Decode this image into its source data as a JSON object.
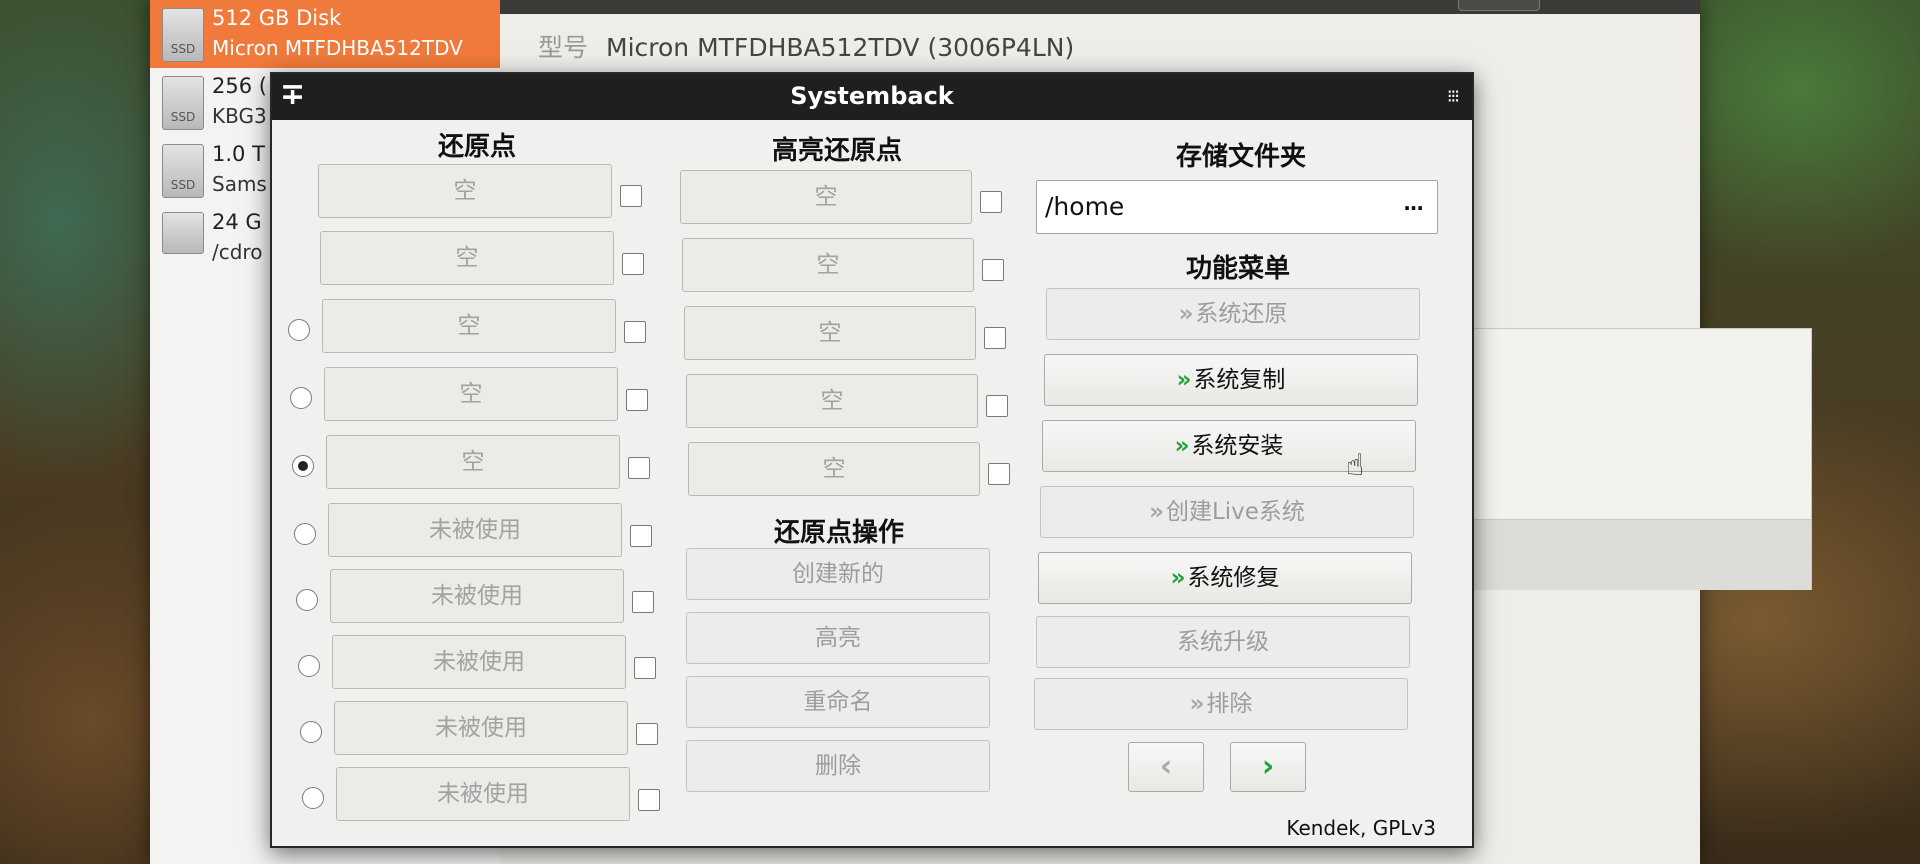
{
  "disks_app": {
    "list": [
      {
        "name": "512 GB Disk",
        "sub": "Micron MTFDHBA512TDV",
        "badge": "SSD",
        "selected": true
      },
      {
        "name": "256 (",
        "sub": "KBG3",
        "badge": "SSD",
        "selected": false
      },
      {
        "name": "1.0 T",
        "sub": "Sams",
        "badge": "SSD",
        "selected": false
      },
      {
        "name": "24 G",
        "sub": "/cdro",
        "badge": "",
        "selected": false
      }
    ],
    "model_label": "型号",
    "model_value": "Micron MTFDHBA512TDV (3006P4LN)"
  },
  "systemback": {
    "title": "Systemback",
    "restore_points": {
      "heading": "还原点",
      "slots": [
        "空",
        "空",
        "空",
        "空",
        "空",
        "未被使用",
        "未被使用",
        "未被使用",
        "未被使用",
        "未被使用"
      ],
      "selected_index": 4
    },
    "highlighted_points": {
      "heading": "高亮还原点",
      "slots": [
        "空",
        "空",
        "空",
        "空",
        "空"
      ]
    },
    "operations": {
      "heading": "还原点操作",
      "create": "创建新的",
      "highlight": "高亮",
      "rename": "重命名",
      "delete": "删除"
    },
    "storage": {
      "heading": "存储文件夹",
      "path": "/home",
      "browse": "..."
    },
    "function_menu": {
      "heading": "功能菜单",
      "chevron": "»",
      "items": [
        {
          "label": "系统还原",
          "enabled": false,
          "chevron": true
        },
        {
          "label": "系统复制",
          "enabled": true,
          "chevron": true
        },
        {
          "label": "系统安装",
          "enabled": true,
          "chevron": true
        },
        {
          "label": "创建Live系统",
          "enabled": false,
          "chevron": true
        },
        {
          "label": "系统修复",
          "enabled": true,
          "chevron": true
        },
        {
          "label": "系统升级",
          "enabled": false,
          "chevron": false
        },
        {
          "label": "排除",
          "enabled": false,
          "chevron": true
        }
      ]
    },
    "nav": {
      "prev": "‹",
      "next": "›"
    },
    "credit": "Kendek, GPLv3"
  }
}
